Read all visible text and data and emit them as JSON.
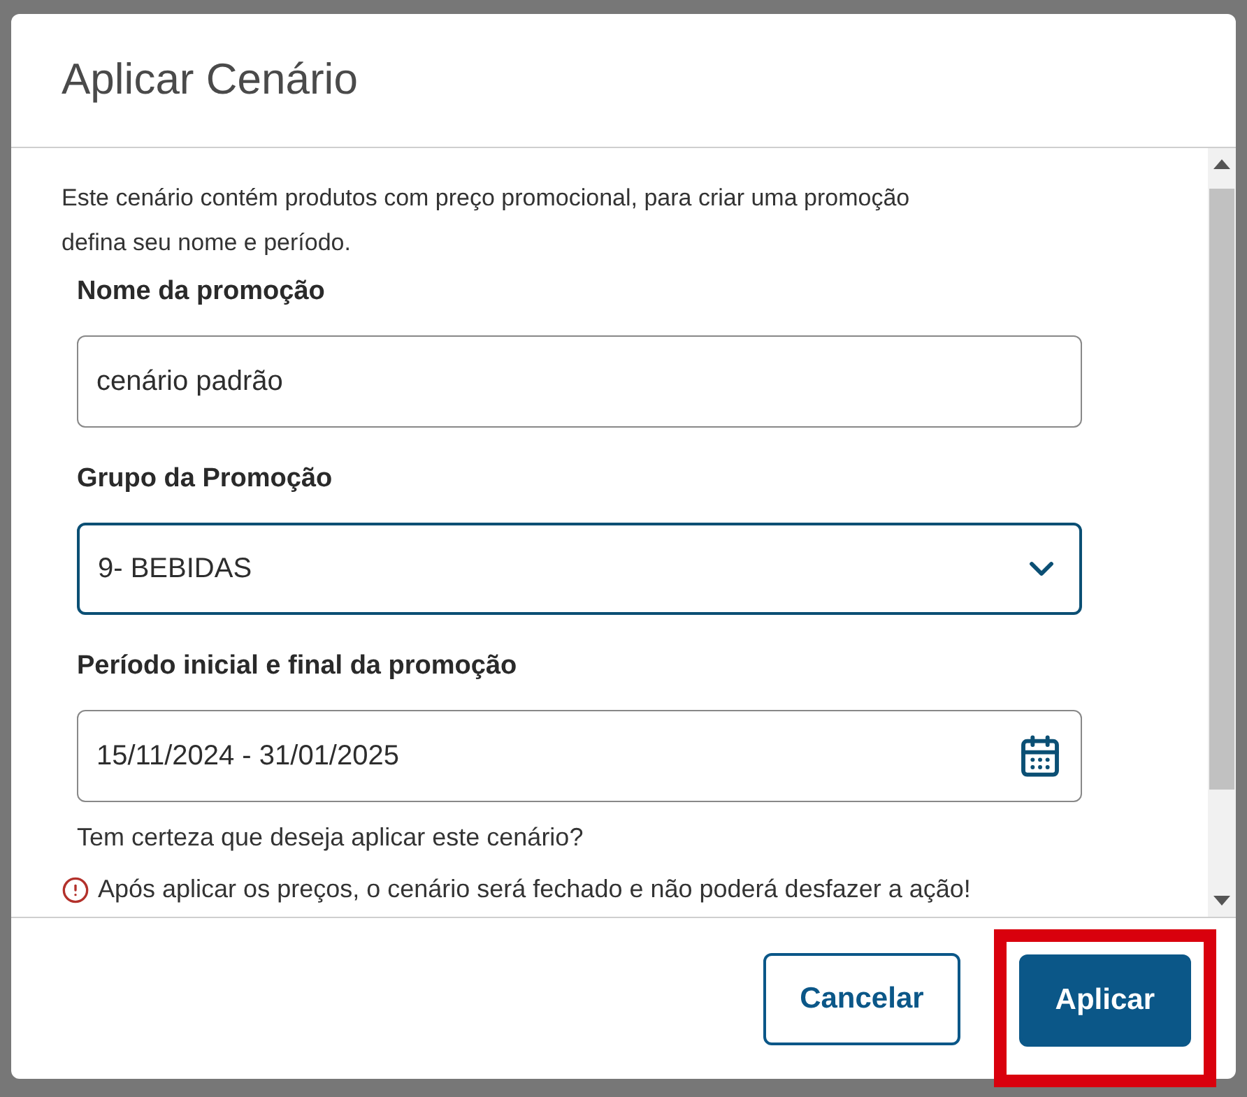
{
  "dialog": {
    "title": "Aplicar Cenário",
    "intro": "Este cenário contém produtos com preço promocional, para criar uma promoção defina seu nome e período.",
    "fields": [
      {
        "kind": "text",
        "label": "Nome da promoção",
        "value": "cenário padrão",
        "focused": false
      },
      {
        "kind": "select",
        "label": "Grupo da Promoção",
        "value": "9- BEBIDAS",
        "focused": true
      },
      {
        "kind": "date",
        "label": "Período inicial e final da promoção",
        "value": "15/11/2024 - 31/01/2025",
        "focused": false
      }
    ],
    "question": "Tem certeza que deseja aplicar este cenário?",
    "warning": "Após aplicar os preços, o cenário será fechado e não poderá desfazer a ação!",
    "buttons": [
      {
        "label": "Cancelar",
        "kind": "secondary",
        "highlighted": false
      },
      {
        "label": "Aplicar",
        "kind": "primary",
        "highlighted": true
      }
    ]
  }
}
